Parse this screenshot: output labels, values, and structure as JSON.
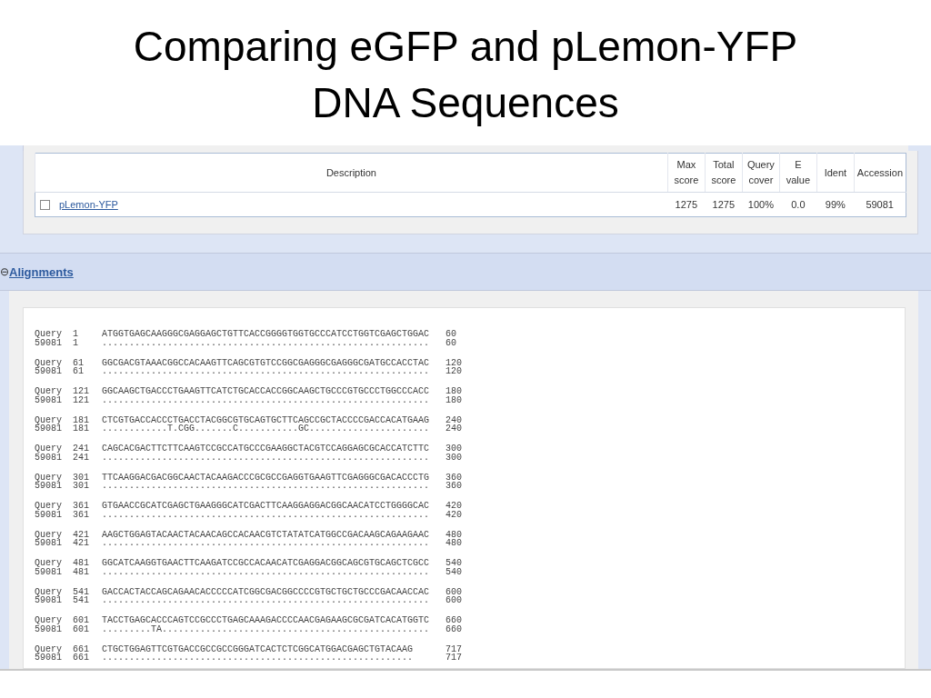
{
  "slide": {
    "title_lines": [
      "Comparing eGFP and pLemon-YFP",
      "DNA Sequences"
    ]
  },
  "results_table": {
    "columns": [
      "Description",
      "Max score",
      "Total score",
      "Query cover",
      "E value",
      "Ident",
      "Accession"
    ],
    "rows": [
      {
        "checked": false,
        "cells": [
          "pLemon-YFP",
          "1275",
          "1275",
          "100%",
          "0.0",
          "99%",
          "59081"
        ]
      }
    ]
  },
  "alignments_section": {
    "toggle": "⊖",
    "title": "Alignments",
    "expanded": true,
    "blocks": [
      {
        "lines": [
          {
            "label": "Query",
            "start": "1",
            "sequence": "ATGGTGAGCAAGGGCGAGGAGCTGTTCACCGGGGTGGTGCCCATCCTGGTCGAGCTGGAC",
            "end": "60"
          },
          {
            "label": "59081",
            "start": "1",
            "sequence": "............................................................",
            "end": "60"
          }
        ]
      },
      {
        "lines": [
          {
            "label": "Query",
            "start": "61",
            "sequence": "GGCGACGTAAACGGCCACAAGTTCAGCGTGTCCGGCGAGGGCGAGGGCGATGCCACCTAC",
            "end": "120"
          },
          {
            "label": "59081",
            "start": "61",
            "sequence": "............................................................",
            "end": "120"
          }
        ]
      },
      {
        "lines": [
          {
            "label": "Query",
            "start": "121",
            "sequence": "GGCAAGCTGACCCTGAAGTTCATCTGCACCACCGGCAAGCTGCCCGTGCCCTGGCCCACC",
            "end": "180"
          },
          {
            "label": "59081",
            "start": "121",
            "sequence": "............................................................",
            "end": "180"
          }
        ]
      },
      {
        "lines": [
          {
            "label": "Query",
            "start": "181",
            "sequence": "CTCGTGACCACCCTGACCTACGGCGTGCAGTGCTTCAGCCGCTACCCCGACCACATGAAG",
            "end": "240"
          },
          {
            "label": "59081",
            "start": "181",
            "sequence": "............T.CGG.......C...........GC......................",
            "end": "240"
          }
        ]
      },
      {
        "lines": [
          {
            "label": "Query",
            "start": "241",
            "sequence": "CAGCACGACTTCTTCAAGTCCGCCATGCCCGAAGGCTACGTCCAGGAGCGCACCATCTTC",
            "end": "300"
          },
          {
            "label": "59081",
            "start": "241",
            "sequence": "............................................................",
            "end": "300"
          }
        ]
      },
      {
        "lines": [
          {
            "label": "Query",
            "start": "301",
            "sequence": "TTCAAGGACGACGGCAACTACAAGACCCGCGCCGAGGTGAAGTTCGAGGGCGACACCCTG",
            "end": "360"
          },
          {
            "label": "59081",
            "start": "301",
            "sequence": "............................................................",
            "end": "360"
          }
        ]
      },
      {
        "lines": [
          {
            "label": "Query",
            "start": "361",
            "sequence": "GTGAACCGCATCGAGCTGAAGGGCATCGACTTCAAGGAGGACGGCAACATCCTGGGGCAC",
            "end": "420"
          },
          {
            "label": "59081",
            "start": "361",
            "sequence": "............................................................",
            "end": "420"
          }
        ]
      },
      {
        "lines": [
          {
            "label": "Query",
            "start": "421",
            "sequence": "AAGCTGGAGTACAACTACAACAGCCACAACGTCTATATCATGGCCGACAAGCAGAAGAAC",
            "end": "480"
          },
          {
            "label": "59081",
            "start": "421",
            "sequence": "............................................................",
            "end": "480"
          }
        ]
      },
      {
        "lines": [
          {
            "label": "Query",
            "start": "481",
            "sequence": "GGCATCAAGGTGAACTTCAAGATCCGCCACAACATCGAGGACGGCAGCGTGCAGCTCGCC",
            "end": "540"
          },
          {
            "label": "59081",
            "start": "481",
            "sequence": "............................................................",
            "end": "540"
          }
        ]
      },
      {
        "lines": [
          {
            "label": "Query",
            "start": "541",
            "sequence": "GACCACTACCAGCAGAACACCCCCATCGGCGACGGCCCCGTGCTGCTGCCCGACAACCAC",
            "end": "600"
          },
          {
            "label": "59081",
            "start": "541",
            "sequence": "............................................................",
            "end": "600"
          }
        ]
      },
      {
        "lines": [
          {
            "label": "Query",
            "start": "601",
            "sequence": "TACCTGAGCACCCAGTCCGCCCTGAGCAAAGACCCCAACGAGAAGCGCGATCACATGGTC",
            "end": "660"
          },
          {
            "label": "59081",
            "start": "601",
            "sequence": ".........TA.................................................",
            "end": "660"
          }
        ]
      },
      {
        "lines": [
          {
            "label": "Query",
            "start": "661",
            "sequence": "CTGCTGGAGTTCGTGACCGCCGCCGGGATCACTCTCGGCATGGACGAGCTGTACAAG",
            "end": "717"
          },
          {
            "label": "59081",
            "start": "661",
            "sequence": ".........................................................",
            "end": "717"
          }
        ]
      }
    ]
  }
}
